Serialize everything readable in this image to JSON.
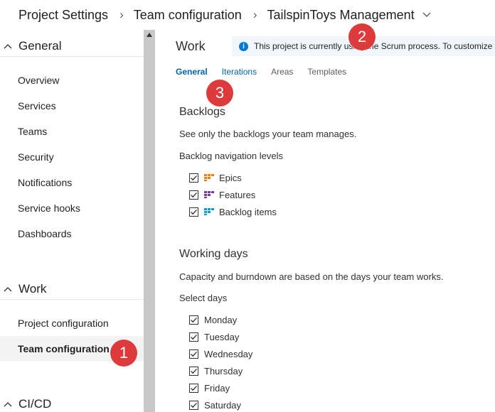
{
  "breadcrumb": {
    "items": [
      "Project Settings",
      "Team configuration",
      "TailspinToys Management"
    ]
  },
  "sidebar": {
    "groups": [
      {
        "label": "General",
        "items": [
          "Overview",
          "Services",
          "Teams",
          "Security",
          "Notifications",
          "Service hooks",
          "Dashboards"
        ]
      },
      {
        "label": "Work",
        "items": [
          "Project configuration",
          "Team configuration"
        ],
        "selected": "Team configuration"
      },
      {
        "label": "CI/CD"
      }
    ]
  },
  "main": {
    "title": "Work",
    "info": "This project is currently using the Scrum process. To customize yo",
    "tabs": [
      "General",
      "Iterations",
      "Areas",
      "Templates"
    ],
    "active_tab": "General",
    "backlogs": {
      "title": "Backlogs",
      "description": "See only the backlogs your team manages.",
      "levels_label": "Backlog navigation levels",
      "levels": [
        {
          "label": "Epics",
          "checked": true,
          "color": "#ff7b00"
        },
        {
          "label": "Features",
          "checked": true,
          "color": "#773b93"
        },
        {
          "label": "Backlog items",
          "checked": true,
          "color": "#009ccc"
        }
      ]
    },
    "working_days": {
      "title": "Working days",
      "description": "Capacity and burndown are based on the days your team works.",
      "select_label": "Select days",
      "days": [
        {
          "label": "Monday",
          "checked": true
        },
        {
          "label": "Tuesday",
          "checked": true
        },
        {
          "label": "Wednesday",
          "checked": true
        },
        {
          "label": "Thursday",
          "checked": true
        },
        {
          "label": "Friday",
          "checked": true
        },
        {
          "label": "Saturday",
          "checked": true
        }
      ]
    }
  },
  "callouts": [
    "1",
    "2",
    "3"
  ],
  "colors": {
    "accent": "#0063b1",
    "callout": "#dd3b3b",
    "info_bg": "#eff6fc"
  }
}
